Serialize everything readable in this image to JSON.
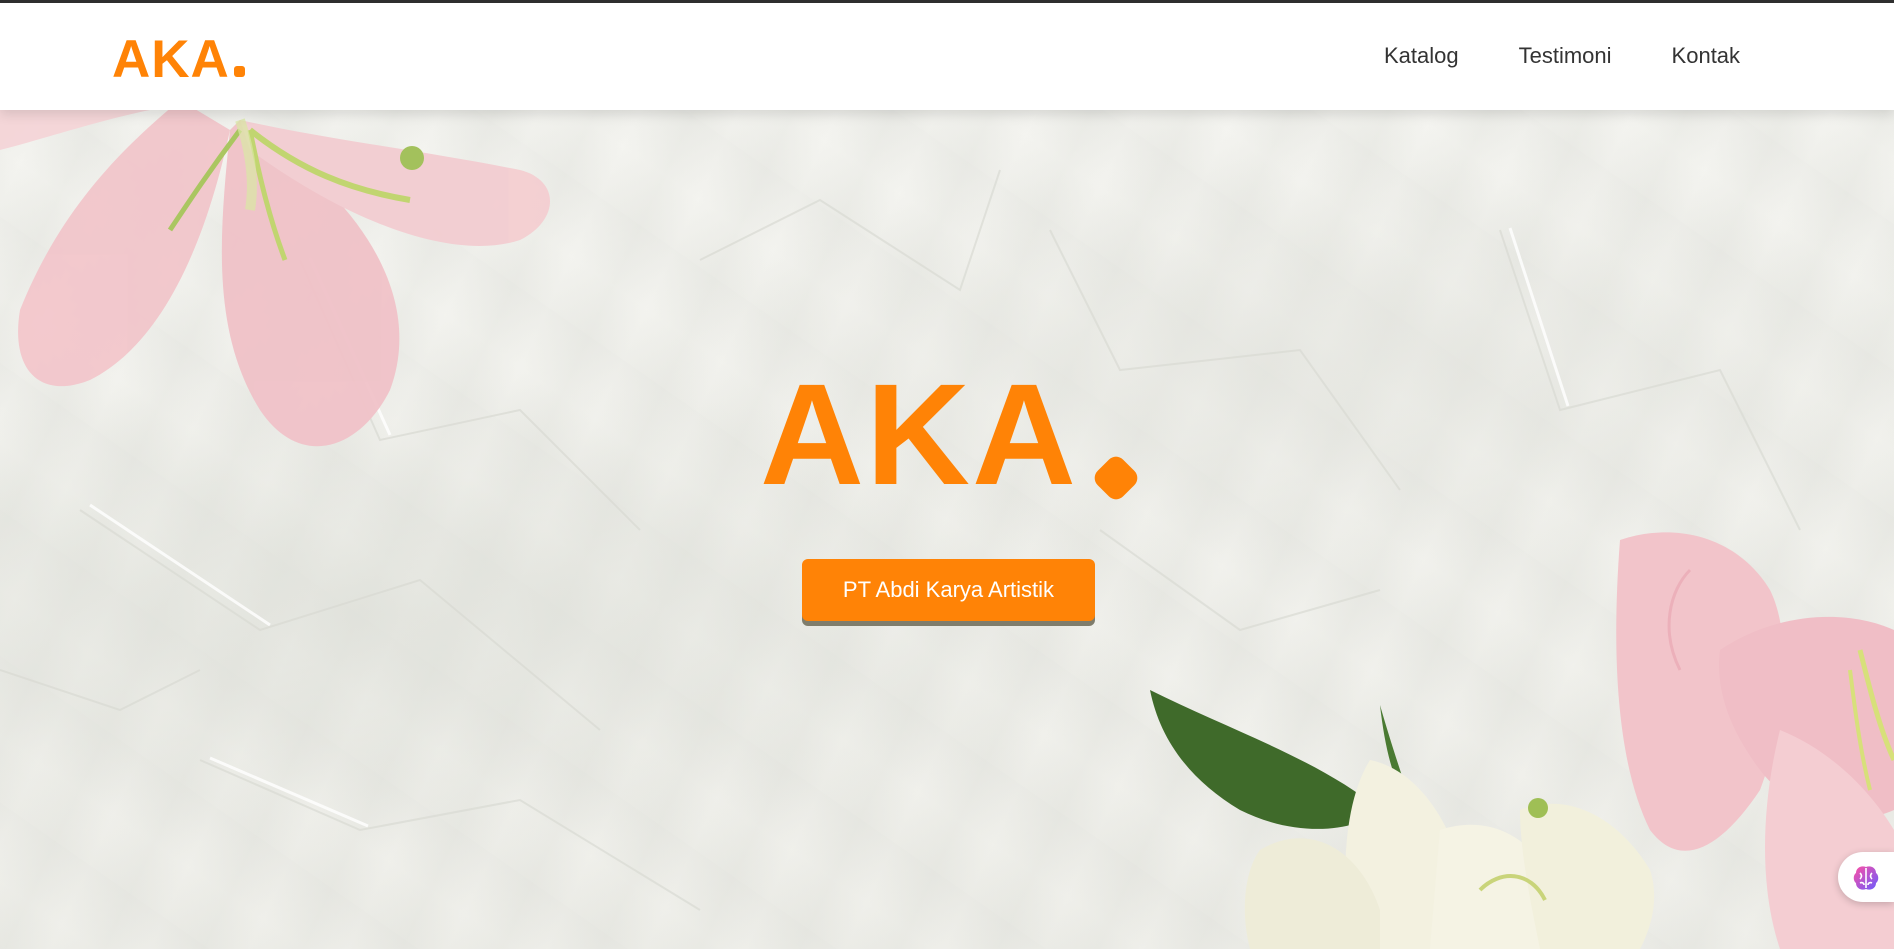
{
  "header": {
    "brand": "AKA",
    "nav": [
      "Katalog",
      "Testimoni",
      "Kontak"
    ]
  },
  "hero": {
    "logo_text": "AKA",
    "button_label": "PT Abdi Karya Artistik"
  },
  "colors": {
    "accent": "#ff8306",
    "nav_text": "#333333",
    "background": "#f3f2ee"
  },
  "icons": {
    "floating_widget": "brain-icon"
  }
}
